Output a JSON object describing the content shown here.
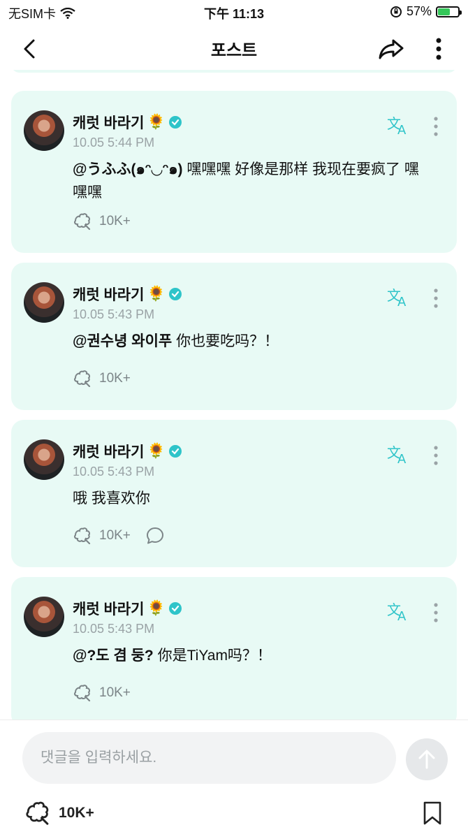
{
  "status_bar": {
    "carrier": "无SIM卡",
    "time": "下午 11:13",
    "battery": "57%"
  },
  "navbar": {
    "title": "포스트"
  },
  "posts": [
    {
      "author": "캐럿 바라기",
      "emoji": "🌻",
      "time": "10.05 5:44 PM",
      "mention": "@うふふ(๑ᵔ◡ᵔ๑)",
      "text": " 嘿嘿嘿 好像是那样 我现在要疯了 嘿嘿嘿",
      "likes": "10K+"
    },
    {
      "author": "캐럿 바라기",
      "emoji": "🌻",
      "time": "10.05 5:43 PM",
      "mention": "@권수녕 와이푸",
      "text": " 你也要吃吗？！",
      "likes": "10K+"
    },
    {
      "author": "캐럿 바라기",
      "emoji": "🌻",
      "time": "10.05 5:43 PM",
      "mention": "",
      "text": "哦 我喜欢你",
      "likes": "10K+"
    },
    {
      "author": "캐럿 바라기",
      "emoji": "🌻",
      "time": "10.05 5:43 PM",
      "mention": "@?도 겸 둥?",
      "text": " 你是TiYam吗？！",
      "likes": "10K+"
    }
  ],
  "composer": {
    "placeholder": "댓글을 입력하세요."
  },
  "footer": {
    "likes": "10K+"
  },
  "colors": {
    "accent": "#2ec4c9",
    "card": "#e8faf5"
  }
}
